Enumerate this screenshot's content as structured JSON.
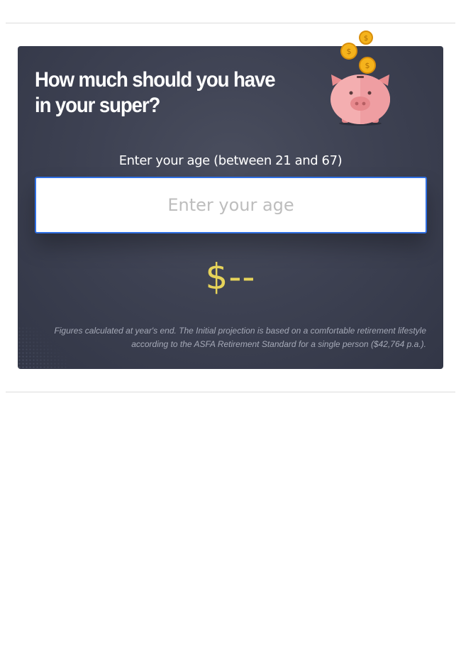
{
  "calculator": {
    "title": "How much should you have in your super?",
    "age_label": "Enter your age (between 21 and 67)",
    "age_input": {
      "value": "",
      "placeholder": "Enter your age"
    },
    "result": "$--",
    "disclaimer": "Figures calculated at year's end. The Initial projection is based on a comfortable retirement lifestyle according to the ASFA Retirement Standard for a single person ($42,764 p.a.).",
    "illustration": {
      "icon": "piggy-bank-icon",
      "coin_icon": "coin-icon",
      "coin_symbol": "$"
    }
  },
  "colors": {
    "card_background": "#3e4253",
    "input_border": "#2f6fe3",
    "result_text": "#e6d35a",
    "coin": "#f5b31c",
    "piggy": "#f1a7a7"
  }
}
